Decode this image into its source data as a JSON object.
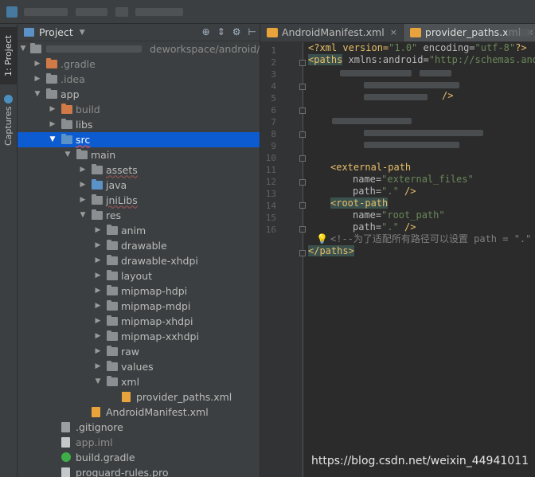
{
  "project_panel": {
    "title": "Project",
    "path_fragment": "deworkspace/android/l",
    "tree": [
      {
        "label": ".gradle",
        "depth": 1,
        "expanded": false,
        "icon": "folder-orange",
        "state": "dim"
      },
      {
        "label": ".idea",
        "depth": 1,
        "expanded": false,
        "icon": "folder",
        "state": "dim"
      },
      {
        "label": "app",
        "depth": 1,
        "expanded": true,
        "icon": "folder",
        "state": "normal"
      },
      {
        "label": "build",
        "depth": 2,
        "expanded": false,
        "icon": "folder-orange",
        "state": "dim"
      },
      {
        "label": "libs",
        "depth": 2,
        "expanded": false,
        "icon": "folder",
        "state": "normal"
      },
      {
        "label": "src",
        "depth": 2,
        "expanded": true,
        "icon": "folder-src",
        "state": "selected"
      },
      {
        "label": "main",
        "depth": 3,
        "expanded": true,
        "icon": "folder",
        "state": "normal"
      },
      {
        "label": "assets",
        "depth": 4,
        "expanded": false,
        "icon": "folder",
        "state": "normal"
      },
      {
        "label": "java",
        "depth": 4,
        "expanded": false,
        "icon": "folder-src",
        "state": "normal"
      },
      {
        "label": "jniLibs",
        "depth": 4,
        "expanded": false,
        "icon": "folder",
        "state": "normal"
      },
      {
        "label": "res",
        "depth": 4,
        "expanded": true,
        "icon": "folder",
        "state": "normal"
      },
      {
        "label": "anim",
        "depth": 5,
        "expanded": false,
        "icon": "folder",
        "state": "normal"
      },
      {
        "label": "drawable",
        "depth": 5,
        "expanded": false,
        "icon": "folder",
        "state": "normal"
      },
      {
        "label": "drawable-xhdpi",
        "depth": 5,
        "expanded": false,
        "icon": "folder",
        "state": "normal"
      },
      {
        "label": "layout",
        "depth": 5,
        "expanded": false,
        "icon": "folder",
        "state": "normal"
      },
      {
        "label": "mipmap-hdpi",
        "depth": 5,
        "expanded": false,
        "icon": "folder",
        "state": "normal"
      },
      {
        "label": "mipmap-mdpi",
        "depth": 5,
        "expanded": false,
        "icon": "folder",
        "state": "normal"
      },
      {
        "label": "mipmap-xhdpi",
        "depth": 5,
        "expanded": false,
        "icon": "folder",
        "state": "normal"
      },
      {
        "label": "mipmap-xxhdpi",
        "depth": 5,
        "expanded": false,
        "icon": "folder",
        "state": "normal"
      },
      {
        "label": "raw",
        "depth": 5,
        "expanded": false,
        "icon": "folder",
        "state": "normal"
      },
      {
        "label": "values",
        "depth": 5,
        "expanded": false,
        "icon": "folder",
        "state": "normal"
      },
      {
        "label": "xml",
        "depth": 5,
        "expanded": true,
        "icon": "folder",
        "state": "normal"
      },
      {
        "label": "provider_paths.xml",
        "depth": 6,
        "expanded": null,
        "icon": "xml-file",
        "state": "normal"
      },
      {
        "label": "AndroidManifest.xml",
        "depth": 4,
        "expanded": null,
        "icon": "xml-file",
        "state": "normal"
      },
      {
        "label": ".gitignore",
        "depth": 2,
        "expanded": null,
        "icon": "gitignore-file",
        "state": "normal"
      },
      {
        "label": "app.iml",
        "depth": 2,
        "expanded": null,
        "icon": "file",
        "state": "dim"
      },
      {
        "label": "build.gradle",
        "depth": 2,
        "expanded": null,
        "icon": "gradle-file",
        "state": "normal"
      },
      {
        "label": "proguard-rules.pro",
        "depth": 2,
        "expanded": null,
        "icon": "file",
        "state": "normal"
      }
    ]
  },
  "tool_strip": {
    "project_tab": "1: Project",
    "captures_tab": "Captures"
  },
  "editor": {
    "tabs": [
      {
        "label": "AndroidManifest.xml",
        "active": false
      },
      {
        "label": "provider_paths.xml",
        "active": true
      }
    ],
    "line_numbers": [
      "1",
      "2",
      "3",
      "4",
      "5",
      "6",
      "7",
      "8",
      "9",
      "10",
      "11",
      "12",
      "13",
      "14",
      "15",
      "16"
    ],
    "code": {
      "l1_a": "<?xml version=",
      "l1_b": "\"1.0\"",
      "l1_c": " encoding=",
      "l1_d": "\"utf-8\"",
      "l1_e": "?>",
      "l2_a": "<paths",
      "l2_b": " xmlns:android=",
      "l2_c": "\"http://schemas.andr",
      "l5_a": "/>",
      "l9_a": "<external-path",
      "l10_a": "name=",
      "l10_b": "\"external_files\"",
      "l11_a": "path=",
      "l11_b": "\".\"",
      "l11_c": " />",
      "l12_a": "<root-path",
      "l13_a": "name=",
      "l13_b": "\"root_path\"",
      "l14_a": "path=",
      "l14_b": "\".\"",
      "l14_c": " />",
      "l15_a": "<!--为了适配所有路径可以设置 path = \".\"",
      "l16_a": "</paths>"
    }
  },
  "watermark": "https://blog.csdn.net/weixin_44941011",
  "colors": {
    "selection": "#0d5bd1",
    "xml_tag": "#e8bf6a",
    "xml_value": "#6a8759",
    "comment": "#808080"
  }
}
